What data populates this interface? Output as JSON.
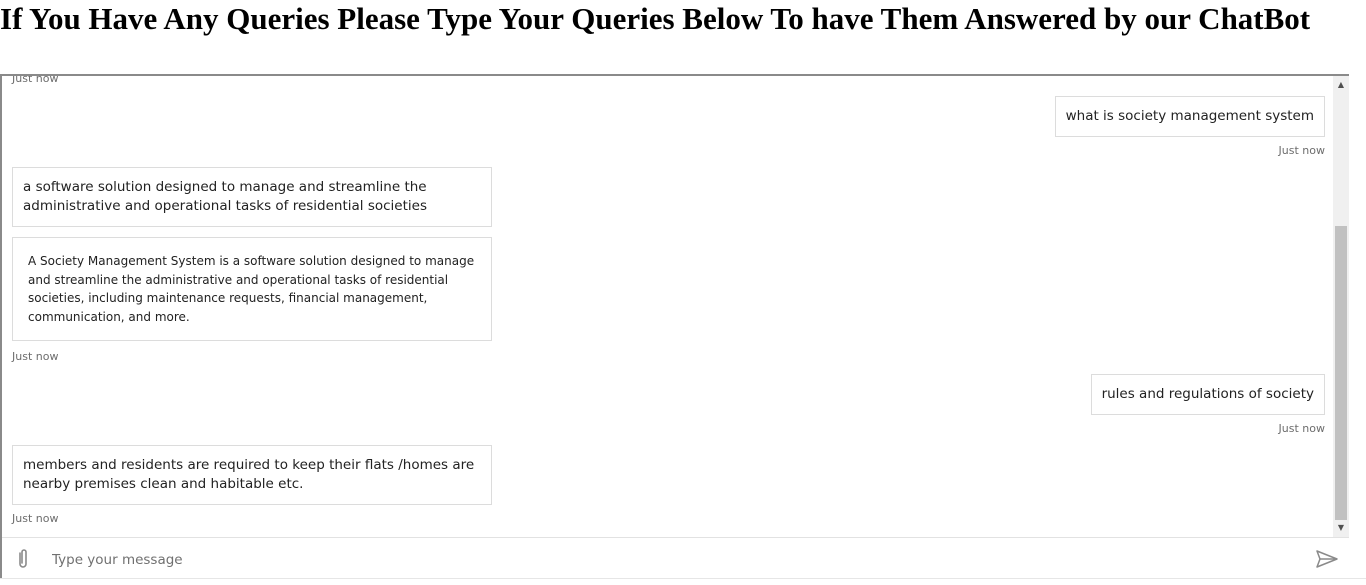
{
  "page": {
    "heading": "If You Have Any Queries Please Type Your Queries Below To have Them Answered by our ChatBot"
  },
  "chat": {
    "messages": [
      {
        "sender": "bot",
        "timestamp": "Just now"
      },
      {
        "sender": "user",
        "text": "what is society management system",
        "timestamp": "Just now"
      },
      {
        "sender": "bot",
        "text": "a software solution designed to manage and streamline the administrative and operational tasks of residential societies"
      },
      {
        "sender": "bot",
        "text": "A Society Management System is a software solution designed to manage and streamline the administrative and operational tasks of residential societies, including maintenance requests, financial management, communication, and more.",
        "timestamp": "Just now"
      },
      {
        "sender": "user",
        "text": "rules and regulations of society",
        "timestamp": "Just now"
      },
      {
        "sender": "bot",
        "text": "members and residents are required to keep their flats /homes are nearby premises clean and habitable etc.",
        "timestamp": "Just now"
      }
    ]
  },
  "composer": {
    "placeholder": "Type your message",
    "value": ""
  },
  "icons": {
    "attach": "paperclip-icon",
    "send": "send-icon",
    "scroll_up": "scroll-up-arrow-icon",
    "scroll_down": "scroll-down-arrow-icon"
  },
  "colors": {
    "bubble_border": "#dcdcdc",
    "timestamp": "#6d6d6d",
    "frame_border": "#8a8a8a"
  }
}
